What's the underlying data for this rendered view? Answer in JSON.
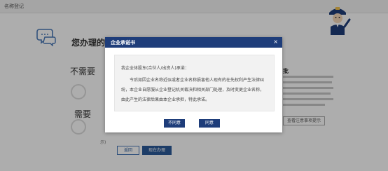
{
  "topbar": {
    "title": "名称登记"
  },
  "background": {
    "heading": "您办理的",
    "option_no_need": "不需要",
    "option_need": "需要",
    "right_title": "批",
    "view_link": "查看注意事项提示",
    "small_text": "示)",
    "back_label": "返回",
    "go_label": "现在办理"
  },
  "modal": {
    "title": "企业承诺书",
    "close": "×",
    "greeting": "我企全体股东(合伙人/出资人)承诺：",
    "paragraph": "今后如因企业名称近似或者企业名称损害他人现有的在先权利产生法律纠纷，本企业自愿服从企业登记机关裁决和相关部门处理，及时变更企业名称，由此产生的法律后果由本企业承担，特此承诺。",
    "disagree_label": "不同意",
    "agree_label": "同意"
  },
  "colors": {
    "modal_header": "#1e3d7a",
    "button": "#1e3d7a",
    "overlay": "rgba(0,0,0,0.32)"
  },
  "icons": [
    "question-bubble-icon",
    "mascot-figure",
    "close-icon"
  ]
}
